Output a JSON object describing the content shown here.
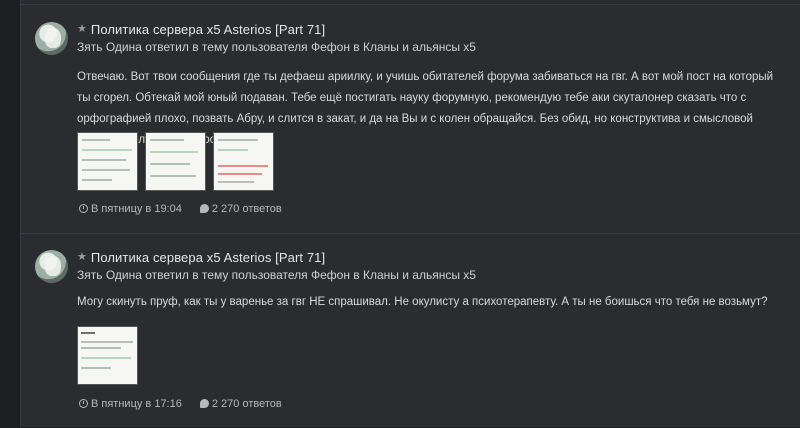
{
  "posts": [
    {
      "title": "Политика сервера x5 Asterios [Part 71]",
      "meta": "Зять Одина ответил в тему пользователя Фефон в Кланы и альянсы x5",
      "body": "Отвечаю. Вот твои сообщения где ты дефаеш ариилку, и учишь обитателей форума забиваться на гвг. А вот мой пост на который ты сгорел. Обтекай мой юный подаван. Тебе ещё постигать науку форумную, рекомендую тебе аки скуталонер сказать что с орфографией плохо, позвать Абру, и слится в закат, и да на Вы и с колен обращайся. Без обид, но конструктива и смысловой нагрузки ноль, просто простыни...",
      "date": "В пятницу в 19:04",
      "replies": "2 270 ответов",
      "thumb_count": 3
    },
    {
      "title": "Политика сервера x5 Asterios [Part 71]",
      "meta": "Зять Одина ответил в тему пользователя Фефон в Кланы и альянсы x5",
      "body": "Могу скинуть пруф, как ты у варенье за гвг НЕ спрашивал. Не окулисту а психотерапевту. А ты не боишься что тебя не возьмут?",
      "date": "В пятницу в 17:16",
      "replies": "2 270 ответов",
      "thumb_count": 1
    }
  ],
  "icons": {
    "star": "star-icon",
    "clock": "clock-icon",
    "replies": "speech-bubble-icon"
  }
}
